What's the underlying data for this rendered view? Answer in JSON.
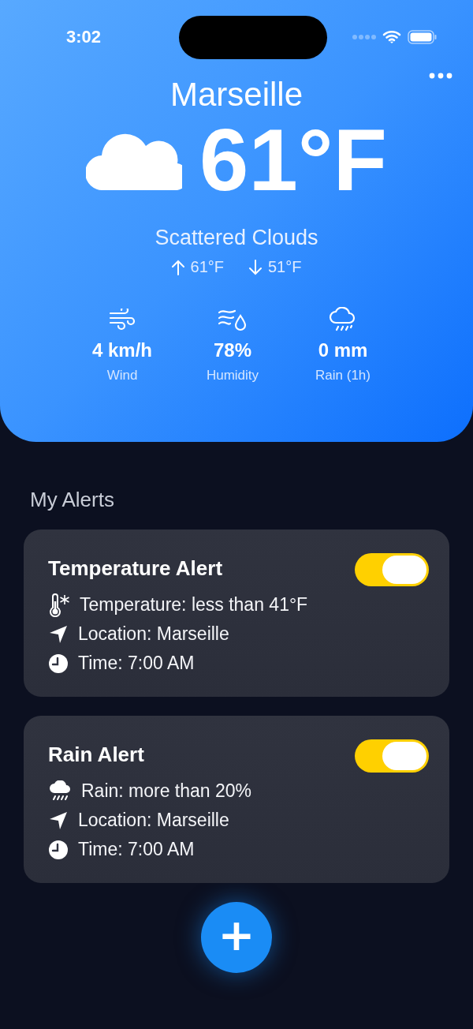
{
  "status_bar": {
    "time": "3:02"
  },
  "header": {
    "city": "Marseille",
    "temperature": "61°F",
    "condition": "Scattered Clouds",
    "high": "61°F",
    "low": "51°F",
    "metrics": [
      {
        "kind": "wind",
        "value": "4 km/h",
        "label": "Wind"
      },
      {
        "kind": "humidity",
        "value": "78%",
        "label": "Humidity"
      },
      {
        "kind": "rain",
        "value": "0 mm",
        "label": "Rain (1h)"
      }
    ]
  },
  "alerts_section": {
    "title": "My Alerts",
    "alerts": [
      {
        "title": "Temperature Alert",
        "on": true,
        "details": [
          {
            "kind": "temperature",
            "text": "Temperature: less than 41°F"
          },
          {
            "kind": "location",
            "text": "Location: Marseille"
          },
          {
            "kind": "time",
            "text": "Time: 7:00 AM"
          }
        ]
      },
      {
        "title": "Rain Alert",
        "on": true,
        "details": [
          {
            "kind": "rain",
            "text": "Rain: more than 20%"
          },
          {
            "kind": "location",
            "text": "Location: Marseille"
          },
          {
            "kind": "time",
            "text": "Time: 7:00 AM"
          }
        ]
      }
    ]
  },
  "add_button": {
    "label": "+"
  }
}
